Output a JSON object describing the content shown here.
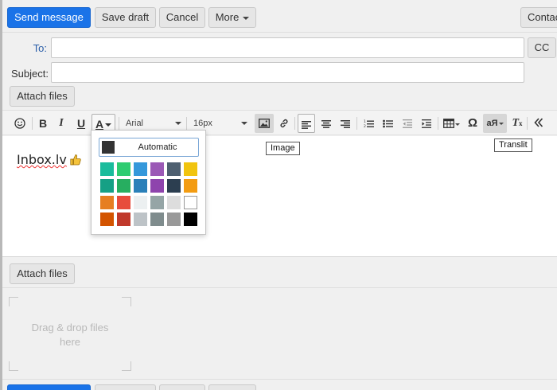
{
  "toolbar": {
    "send_label": "Send message",
    "save_draft_label": "Save draft",
    "cancel_label": "Cancel",
    "more_label": "More",
    "contacts_label": "Contac"
  },
  "header": {
    "to_label": "To:",
    "to_value": "",
    "cc_label": "CC",
    "subject_label": "Subject:",
    "subject_value": "",
    "attach_label": "Attach files"
  },
  "editor_toolbar": {
    "font_family": "Arial",
    "font_size": "16px",
    "items": [
      "emoji-icon",
      "bold",
      "italic",
      "underline",
      "text-color",
      "font-family",
      "font-size",
      "image",
      "link",
      "align-left",
      "align-center",
      "align-right",
      "ordered-list",
      "bullet-list",
      "outdent",
      "indent",
      "table",
      "special-char",
      "translit",
      "clear-format",
      "collapse"
    ]
  },
  "color_palette": {
    "automatic_label": "Automatic",
    "automatic_color": "#333333",
    "rows": [
      [
        "#1abc9c",
        "#2ecc71",
        "#3498db",
        "#9b59b6",
        "#4e5f70",
        "#f1c40f"
      ],
      [
        "#16a085",
        "#27ae60",
        "#2a80b9",
        "#8e44ad",
        "#2c3e50",
        "#f39c12"
      ],
      [
        "#e67e22",
        "#e74c3c",
        "#ecf0f1",
        "#95a5a6",
        "#dddddd",
        "#ffffff"
      ],
      [
        "#d35400",
        "#c0392b",
        "#bdc3c7",
        "#7f8c8d",
        "#999999",
        "#000000"
      ]
    ]
  },
  "tooltips": {
    "image": "Image",
    "translit": "Translit"
  },
  "editor": {
    "text": "Inbox.lv"
  },
  "attachments": {
    "attach_label": "Attach files",
    "dropzone_text": "Drag & drop files here"
  },
  "colors": {
    "primary": "#1a73e8"
  }
}
